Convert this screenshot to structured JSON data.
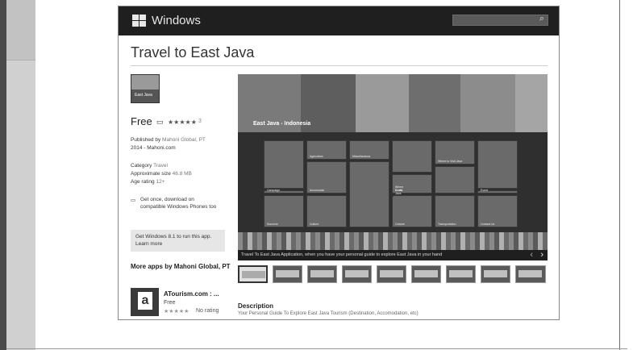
{
  "header": {
    "brand": "Windows",
    "search_placeholder": ""
  },
  "app": {
    "title": "Travel to East Java",
    "icon_text": "East Java",
    "price": "Free",
    "stars": "★★★★★",
    "rating_count": "3",
    "published_by_label": "Published by",
    "publisher": "Mahoni Global, PT",
    "copyright": "2014 - Mahoni.com",
    "category_label": "Category",
    "category": "Travel",
    "size_label": "Approximate size",
    "size": "46.8 MB",
    "age_label": "Age rating",
    "age": "12+",
    "phone_note_line1": "Get once, download on",
    "phone_note_line2": "compatible Windows Phones too",
    "win81_note": "Get Windows 8.1 to run this app.",
    "learn_more": "Learn more"
  },
  "screenshot": {
    "banner_label": "East Java - Indonesia",
    "caption": "Travel To East Java Application, when you have your personal guide to explore East Java in your hand",
    "tiles": [
      "",
      "Agriculture",
      "Miscellaneous",
      "",
      "Where to Visit Java",
      "",
      "Campaign",
      "Accomodat.",
      "",
      "Crafts",
      "",
      "Event",
      "Souvenir",
      "Culture",
      "Cuisine",
      "Where to eat Java",
      "Transportation",
      "Contact Us"
    ]
  },
  "more_apps": {
    "title": "More apps by Mahoni Global, PT",
    "item_name": "ATourism.com : ...",
    "item_price": "Free",
    "item_stars": "★★★★★",
    "item_rating": "No rating"
  },
  "description": {
    "title": "Description",
    "text": "Your Personal Guide To Explore East Java Tourism (Destination, Accomodation, etc)"
  }
}
